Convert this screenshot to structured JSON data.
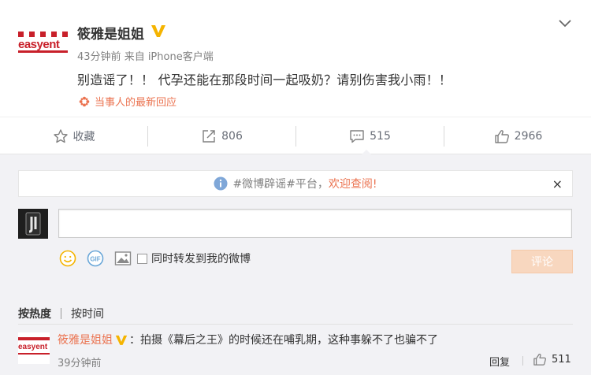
{
  "post": {
    "author": "筱雅是姐姐",
    "avatar_logo": "easyent",
    "time": "43分钟前",
    "source": "来自 iPhone客户端",
    "text": "别造谣了！！ 代孕还能在那段时间一起吸奶？请别伤害我小雨！！",
    "reply_link": "当事人的最新回应",
    "verified_badge": "verified-v-icon",
    "menu_icon": "chevron-down-icon"
  },
  "actions": {
    "favorite_label": "收藏",
    "repost_count": "806",
    "comment_count": "515",
    "like_count": "2966"
  },
  "notice": {
    "text": "#微博辟谣#平台，",
    "link": "欢迎查阅!",
    "close": "×"
  },
  "composer": {
    "input_value": "",
    "checkbox_label": "同时转发到我的微博",
    "submit_label": "评论",
    "tools": [
      "emoji-icon",
      "gif-icon",
      "image-icon"
    ]
  },
  "sort": {
    "hot": "按热度",
    "time": "按时间"
  },
  "comment": {
    "author": "筱雅是姐姐",
    "avatar_logo": "easyent",
    "text": "：拍摄《幕后之王》的时候还在哺乳期，这种事躲不了也骗不了",
    "time": "39分钟前",
    "reply_label": "回复",
    "like_count": "511"
  },
  "colors": {
    "accent": "#eb7350",
    "badge_gold": "#f5b400",
    "brand_red": "#c8202a",
    "panel_bg": "#f2f2f5",
    "submit_disabled": "#f8d7bf"
  }
}
